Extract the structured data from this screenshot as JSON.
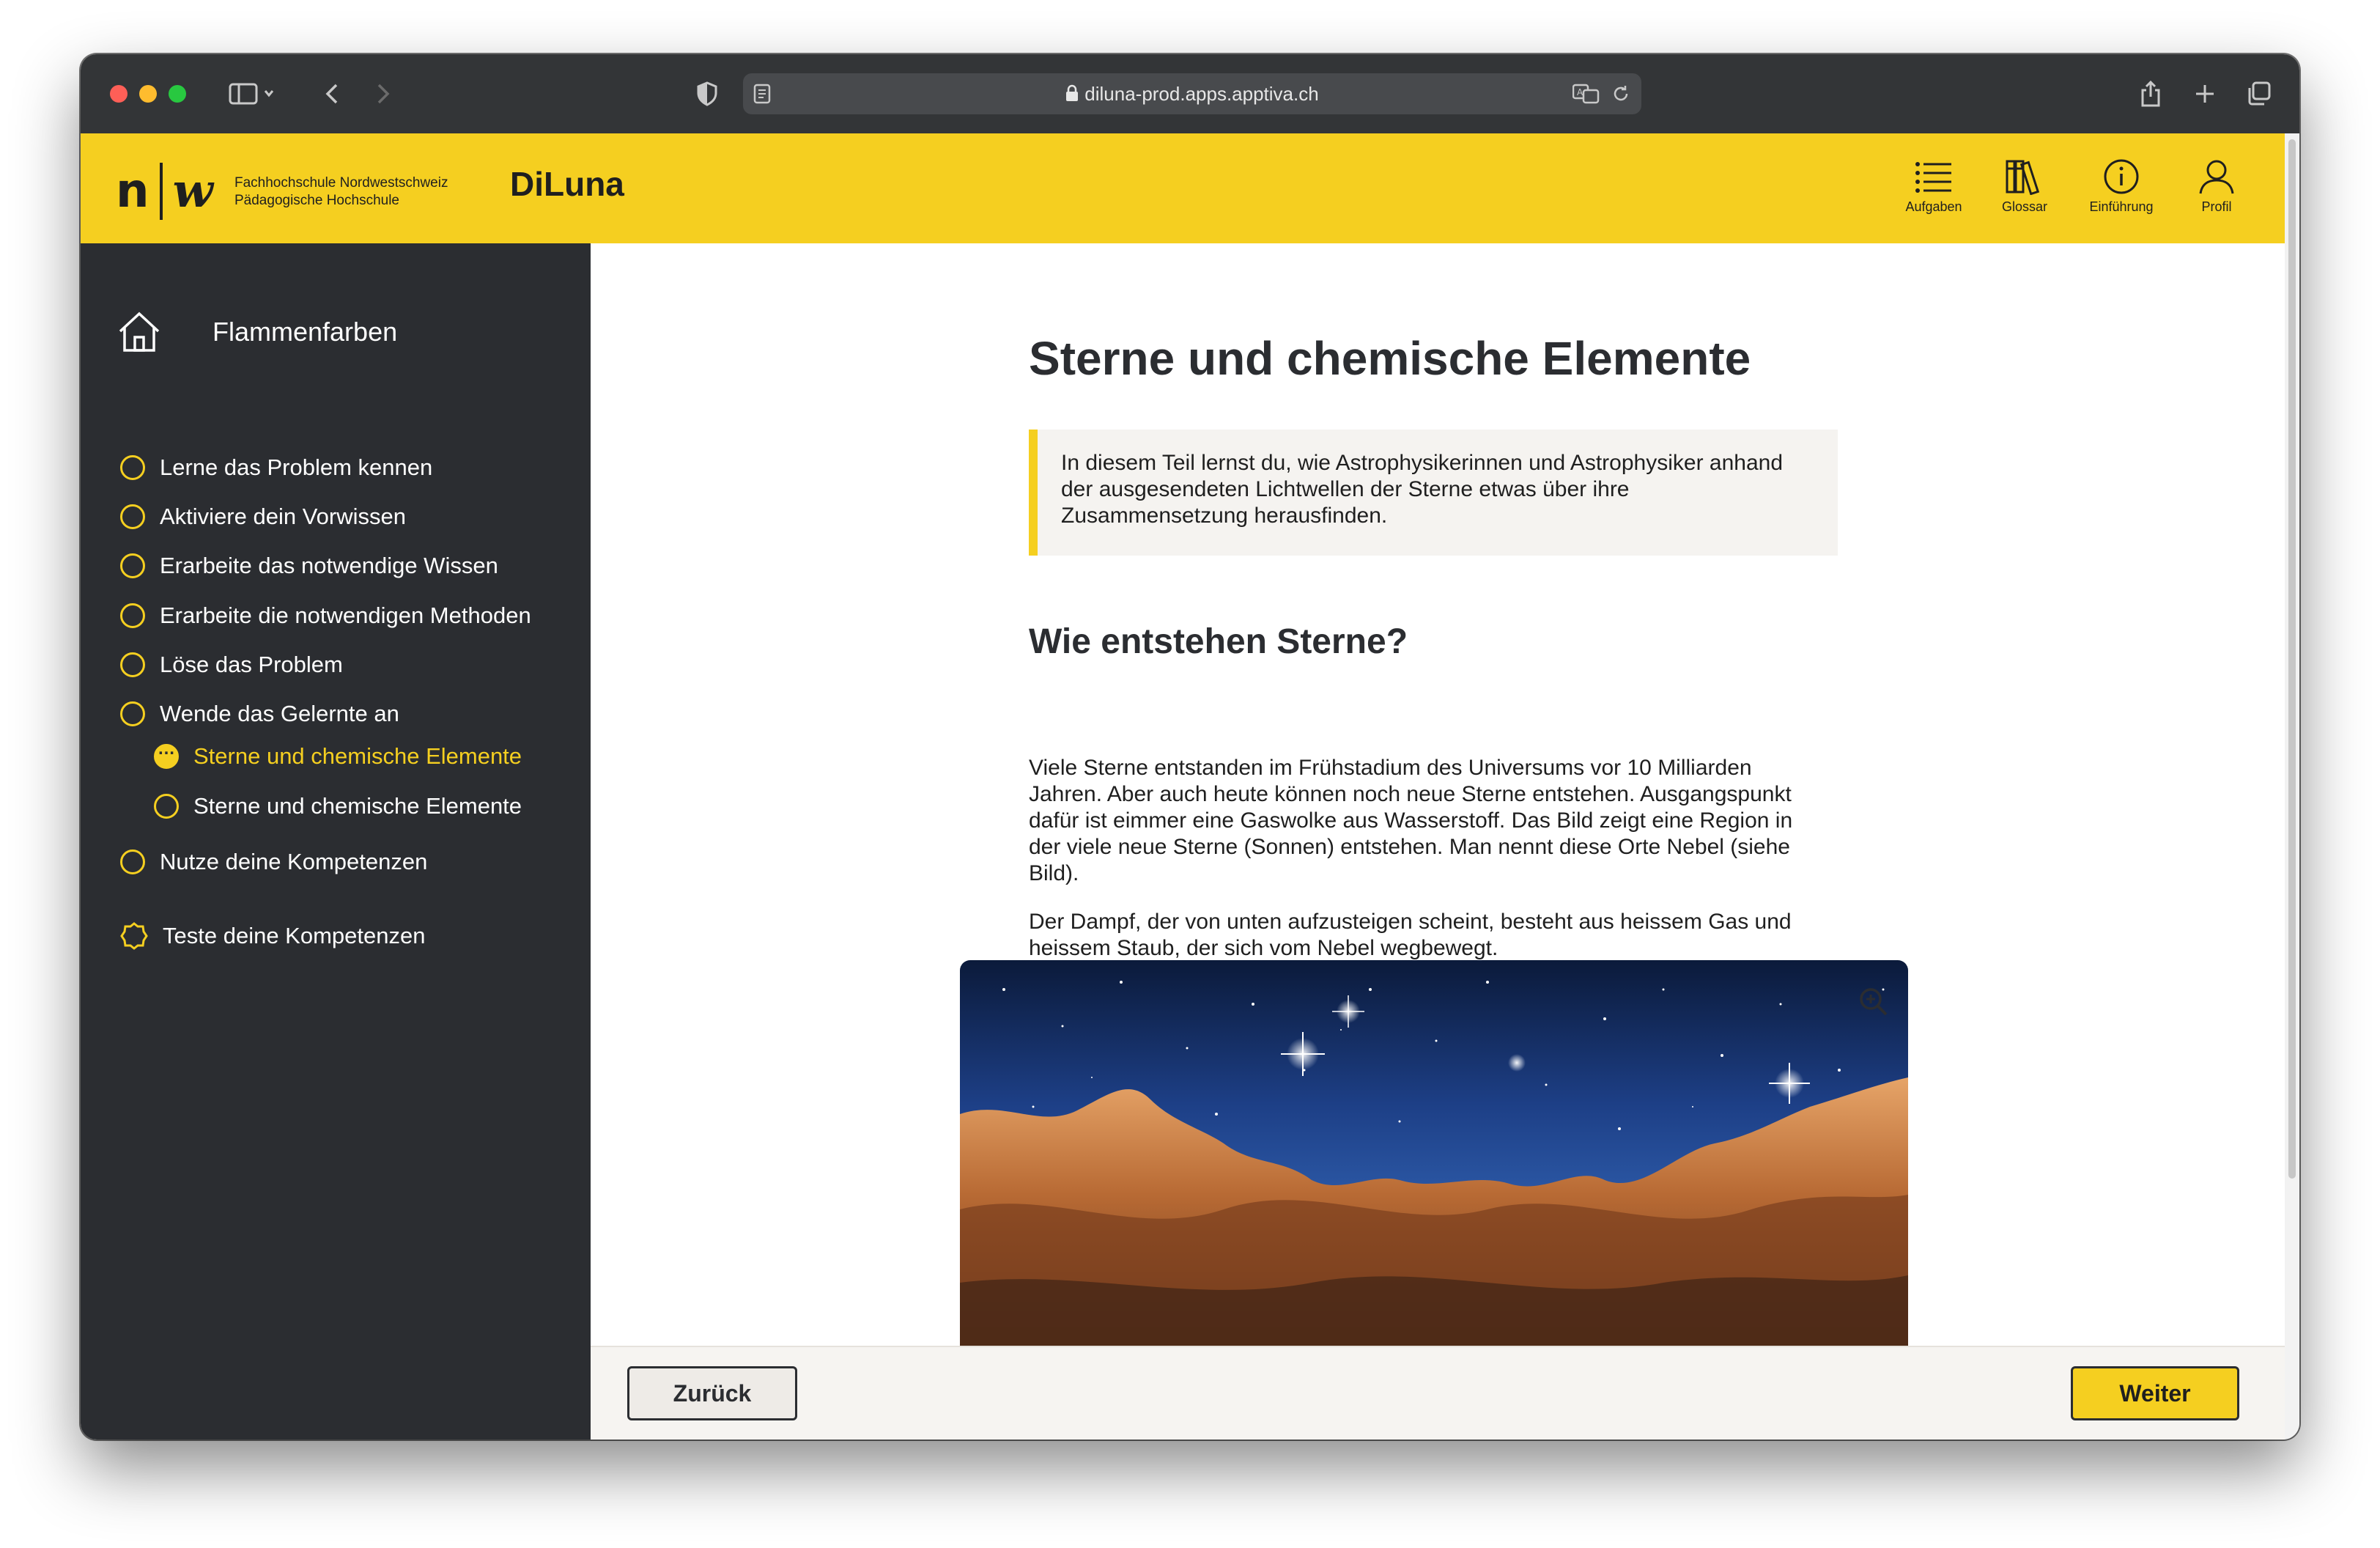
{
  "browser": {
    "url": "diluna-prod.apps.apptiva.ch"
  },
  "header": {
    "logo_n": "n",
    "logo_w": "w",
    "school_line1": "Fachhochschule Nordwestschweiz",
    "school_line2": "Pädagogische Hochschule",
    "brand": "DiLuna",
    "nav": [
      {
        "label": "Aufgaben",
        "icon": "list-icon"
      },
      {
        "label": "Glossar",
        "icon": "books-icon"
      },
      {
        "label": "Einführung",
        "icon": "info-icon"
      },
      {
        "label": "Profil",
        "icon": "user-icon"
      }
    ],
    "accent_color": "#f5cf20"
  },
  "sidebar": {
    "title": "Flammenfarben",
    "items": [
      {
        "label": "Lerne das Problem kennen",
        "state": "open"
      },
      {
        "label": "Aktiviere dein Vorwissen",
        "state": "open"
      },
      {
        "label": "Erarbeite das notwendige Wissen",
        "state": "open"
      },
      {
        "label": "Erarbeite die notwendigen Methoden",
        "state": "open"
      },
      {
        "label": "Löse das Problem",
        "state": "open"
      },
      {
        "label": "Wende das Gelernte an",
        "state": "open"
      },
      {
        "label": "Sterne und chemische Elemente",
        "state": "in-progress",
        "sub": true
      },
      {
        "label": "Sterne und chemische Elemente",
        "state": "open",
        "sub": true
      },
      {
        "label": "Nutze deine Kompetenzen",
        "state": "open"
      },
      {
        "label": "Teste deine Kompetenzen",
        "state": "test"
      }
    ]
  },
  "content": {
    "title": "Sterne und chemische Elemente",
    "callout": "In diesem Teil lernst du, wie Astrophysikerinnen und Astrophysiker anhand der ausgesendeten Lichtwellen der Sterne etwas über ihre Zusammensetzung herausfinden.",
    "section_title": "Wie entstehen Sterne?",
    "paragraph1": "Viele Sterne entstanden im Frühstadium des Universums vor 10 Milliarden Jahren. Aber auch heute können noch neue Sterne entstehen. Ausgangspunkt dafür ist eimmer eine Gaswolke aus Wasserstoff. Das Bild zeigt eine Region in der viele neue Sterne (Sonnen) entstehen. Man nennt diese Orte Nebel (siehe Bild).",
    "paragraph2": "Der Dampf, der von unten aufzusteigen scheint, besteht aus heissem Gas und heissem Staub, der sich vom Nebel wegbewegt.",
    "image_zoom_icon": "zoom-in-icon"
  },
  "footer": {
    "back_label": "Zurück",
    "next_label": "Weiter"
  }
}
